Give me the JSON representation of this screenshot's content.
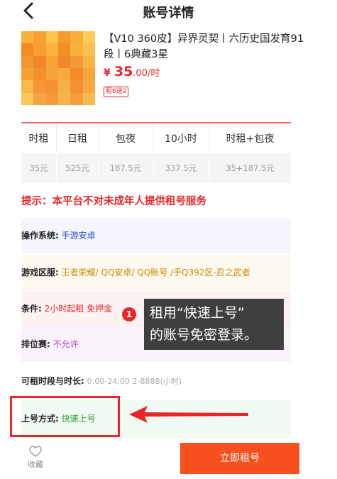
{
  "header": {
    "title": "账号详情"
  },
  "product": {
    "title": "【V10 360皮】异界灵契丨六历史国发育91段丨6典藏3星",
    "price_currency": "¥",
    "price_value": "35",
    "price_decimal": ".00",
    "price_unit": "/时",
    "tag": "租6送2"
  },
  "rates": {
    "headers": [
      "时租",
      "日租",
      "包夜",
      "10小时",
      "时租+包夜"
    ],
    "values": [
      "35元",
      "525元",
      "187.5元",
      "337.5元",
      "35+187.5元"
    ]
  },
  "notice": "提示：本平台不对未成年人提供租号服务",
  "info": {
    "os_label": "操作系统:",
    "os_value": "手游安卓",
    "zone_label": "游戏区服:",
    "zone_value": "王者荣耀/ QQ安卓/ QQ账号 /手Q392区-忍之武者",
    "cond_label": "条件:",
    "cond_value": "2小时起租 免押金",
    "rank_label": "排位赛:",
    "rank_value": "不允许",
    "period_label": "可租时段与时长:",
    "period_value": "0:00-24:00 2-8888(小时)",
    "login_label": "上号方式:",
    "login_value": "快速上号"
  },
  "annotation": {
    "badge": "1",
    "tooltip_line1": "租用“快速上号”",
    "tooltip_line2": "的账号免密登录。"
  },
  "bottom": {
    "fav_label": "收藏",
    "rent_button": "立即租号"
  },
  "colors": {
    "accent_red": "#e8262a",
    "rent_orange": "#f6501e",
    "tooltip_bg": "#3f3f3f"
  }
}
